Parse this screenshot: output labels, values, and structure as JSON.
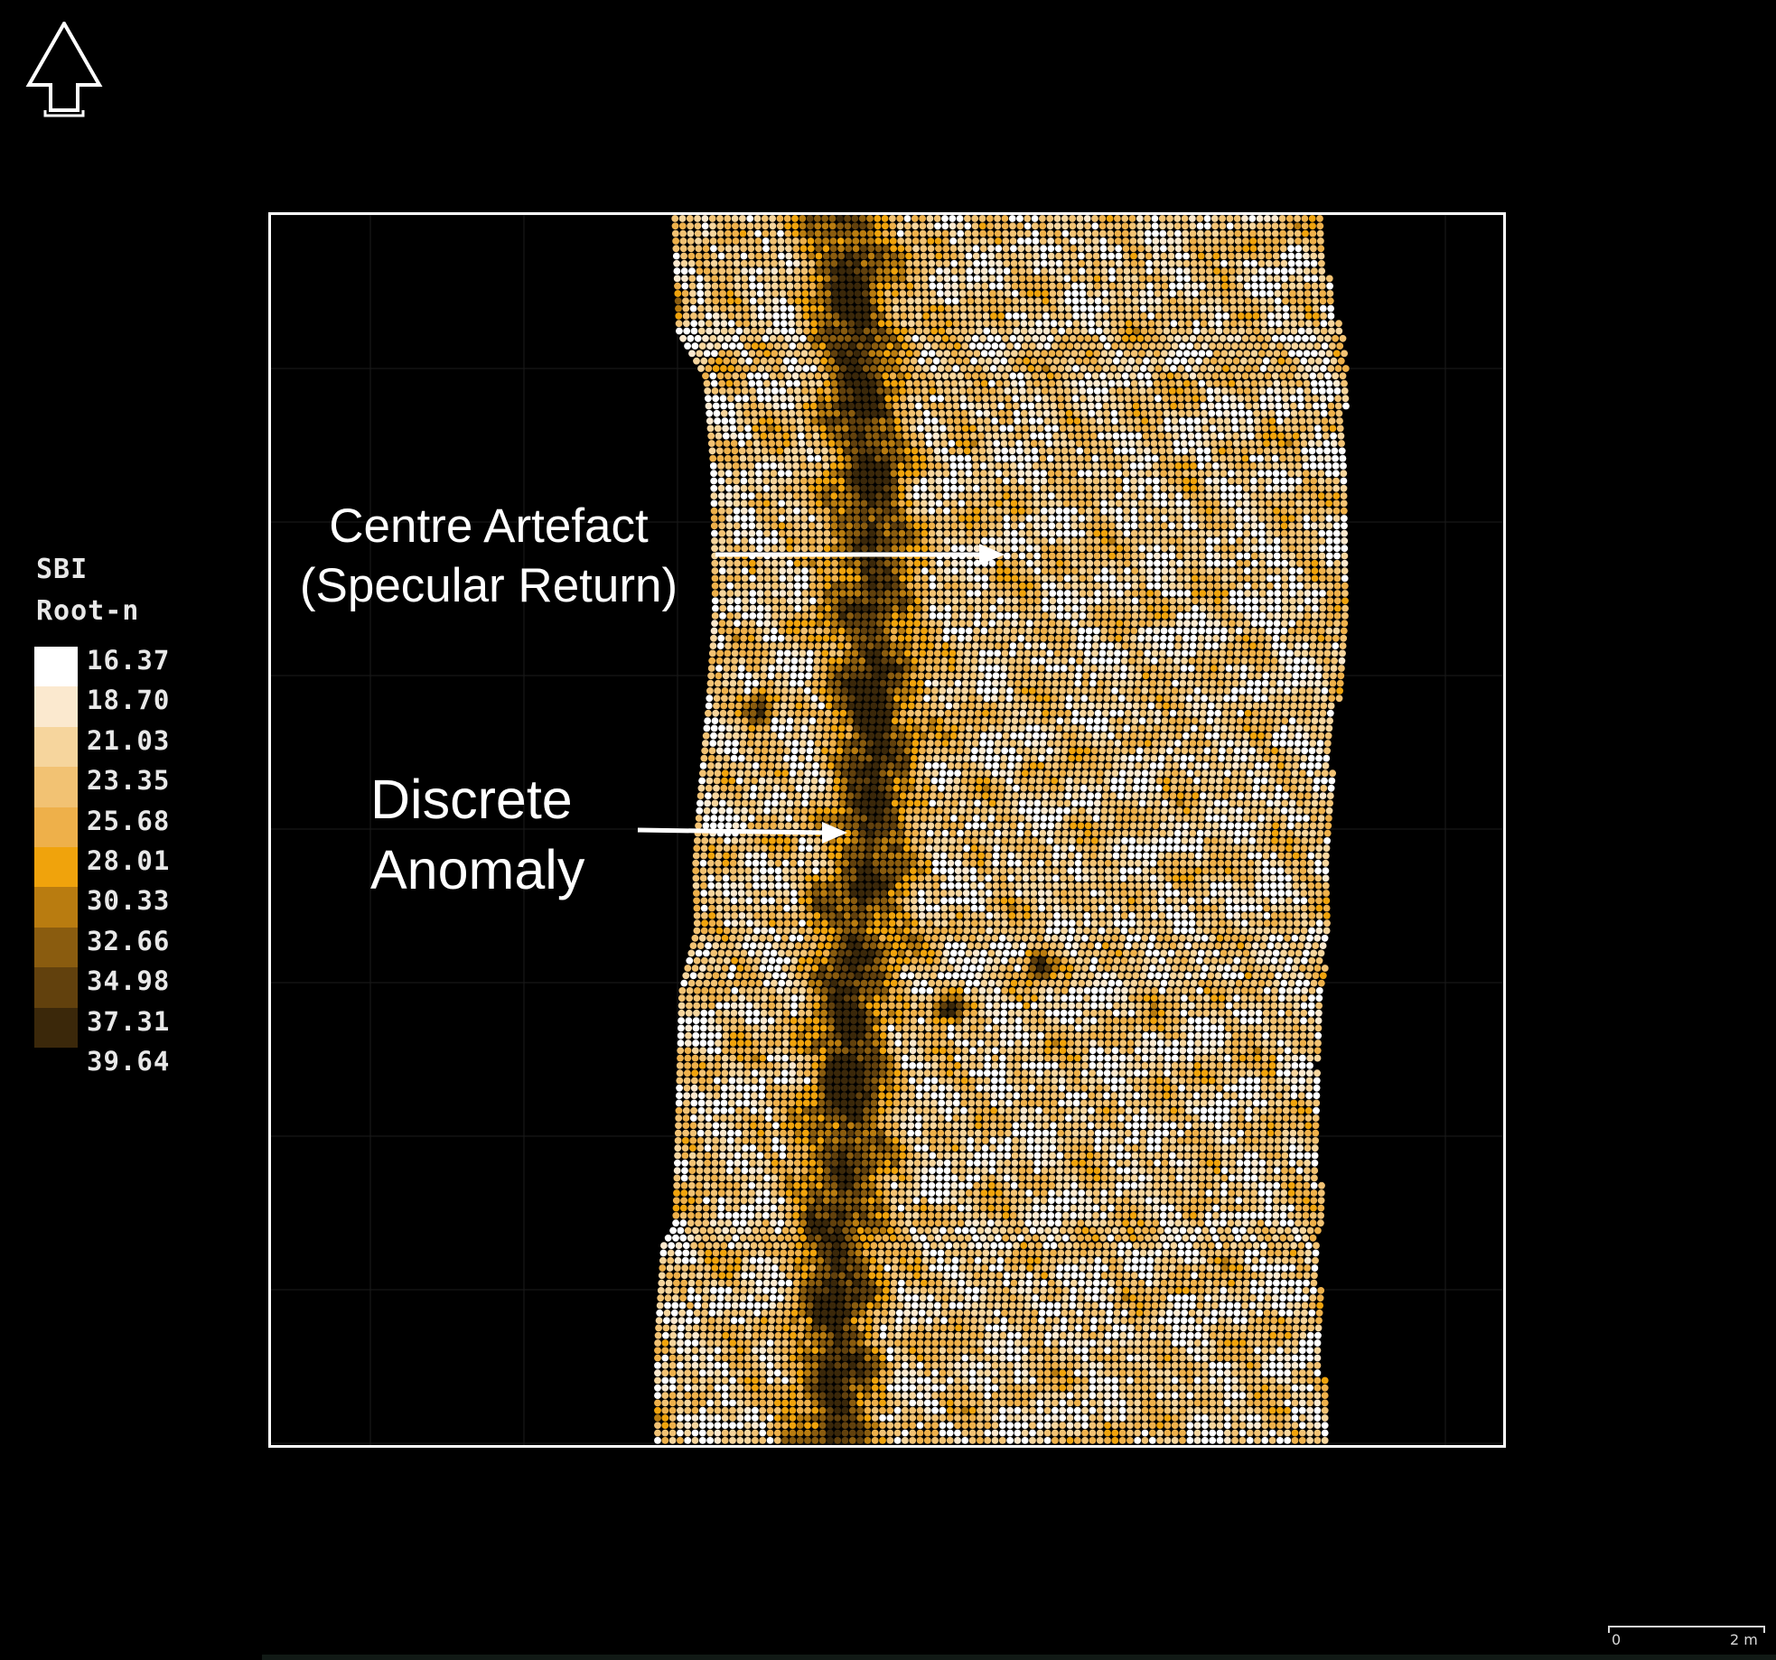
{
  "legend": {
    "title_line1": "SBI",
    "title_line2": "Root-n",
    "values": [
      "16.37",
      "18.70",
      "21.03",
      "23.35",
      "25.68",
      "28.01",
      "30.33",
      "32.66",
      "34.98",
      "37.31",
      "39.64"
    ],
    "colors": [
      "#ffffff",
      "#fbe9cf",
      "#f6d59d",
      "#f2c273",
      "#eeb04a",
      "#f0a30c",
      "#b97c10",
      "#8a5c0f",
      "#62410d",
      "#3b280a"
    ]
  },
  "annotations": {
    "centre_line1": "Centre Artefact",
    "centre_line2": "(Specular Return)",
    "discrete_line1": "Discrete",
    "discrete_line2": "Anomaly"
  },
  "scale_bar": {
    "start_label": "0",
    "end_label": "2 m"
  },
  "colors": {
    "background": "#000000",
    "frame": "#ffffff",
    "annotation_text": "#ffffff"
  }
}
